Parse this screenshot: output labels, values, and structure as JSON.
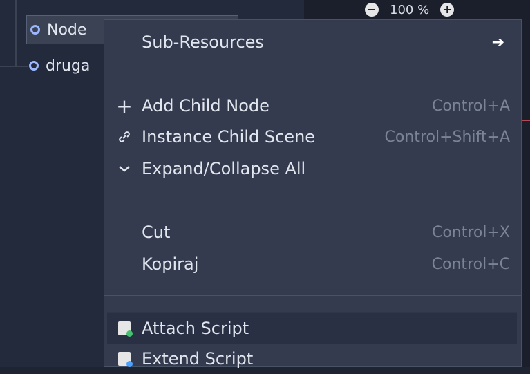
{
  "scene_tree": {
    "nodes": [
      {
        "label": "Node",
        "selected": true,
        "icon": "node-circle-icon"
      },
      {
        "label": "druga",
        "selected": false,
        "icon": "node-circle-icon"
      }
    ]
  },
  "viewport": {
    "zoom_level": "100 %"
  },
  "context_menu": {
    "items": [
      {
        "label": "Sub-Resources",
        "shortcut": "",
        "icon": "",
        "has_submenu": true
      },
      {
        "label": "Add Child Node",
        "shortcut": "Control+A",
        "icon": "plus-icon"
      },
      {
        "label": "Instance Child Scene",
        "shortcut": "Control+Shift+A",
        "icon": "link-icon"
      },
      {
        "label": "Expand/Collapse All",
        "shortcut": "",
        "icon": "chevron-down-icon"
      },
      {
        "label": "Cut",
        "shortcut": "Control+X",
        "icon": ""
      },
      {
        "label": "Kopiraj",
        "shortcut": "Control+C",
        "icon": ""
      },
      {
        "label": "Attach Script",
        "shortcut": "",
        "icon": "attach-script-icon",
        "hover": true
      },
      {
        "label": "Extend Script",
        "shortcut": "",
        "icon": "extend-script-icon"
      }
    ]
  },
  "colors": {
    "menu_bg": "#343b4f",
    "tree_bg": "#232a3b",
    "node_icon": "#9db7ff",
    "shortcut_text": "#7b8396"
  }
}
